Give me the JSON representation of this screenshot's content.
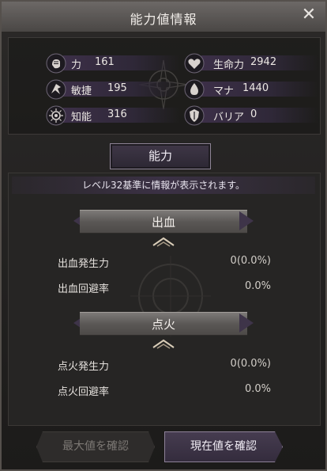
{
  "window": {
    "title": "能力値情報",
    "close_glyph": "✕"
  },
  "stats": {
    "left": [
      {
        "icon": "fist-icon",
        "label": "力",
        "value": "161"
      },
      {
        "icon": "agility-icon",
        "label": "敏捷",
        "value": "195"
      },
      {
        "icon": "eye-icon",
        "label": "知能",
        "value": "316"
      }
    ],
    "right": [
      {
        "icon": "heart-icon",
        "label": "生命力",
        "value": "2942"
      },
      {
        "icon": "mana-icon",
        "label": "マナ",
        "value": "1440"
      },
      {
        "icon": "barrier-icon",
        "label": "バリア",
        "value": "0"
      }
    ]
  },
  "tab": {
    "label": "能力"
  },
  "info_text": "レベル32基準に情報が表示されます。",
  "sections": [
    {
      "title": "出血",
      "rows": [
        {
          "label": "出血発生力",
          "value": "0(0.0%)"
        },
        {
          "label": "出血回避率",
          "value": "0.0%"
        }
      ]
    },
    {
      "title": "点火",
      "rows": [
        {
          "label": "点火発生力",
          "value": "0(0.0%)"
        },
        {
          "label": "点火回避率",
          "value": "0.0%"
        }
      ]
    }
  ],
  "buttons": {
    "max_label": "最大値を確認",
    "current_label": "現在値を確認"
  },
  "colors": {
    "accent_purple": "#3c2f48",
    "panel_bg": "#262524",
    "header_bar": "#5b5856"
  }
}
